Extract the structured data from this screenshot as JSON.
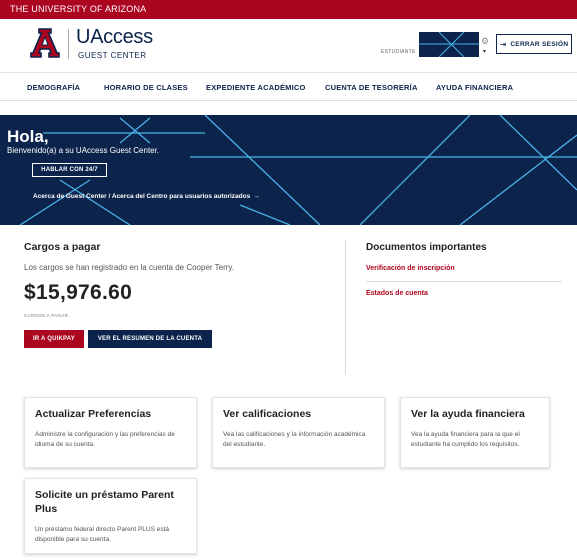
{
  "university_bar": {
    "text": "THE UNIVERSITY OF ARIZONA"
  },
  "header": {
    "logo_icon": "arizona-a-logo",
    "brand_title": "UAccess",
    "brand_subtitle": "GUEST CENTER",
    "student_label": "ESTUDIANTE",
    "settings_icon": "⚙",
    "caret_icon": "▾",
    "logout_icon": "⇥",
    "logout_label": "CERRAR SESIÓN"
  },
  "nav": {
    "items": [
      {
        "label": "DEMOGRAFÍA"
      },
      {
        "label": "HORARIO DE CLASES"
      },
      {
        "label": "EXPEDIENTE ACADÉMICO"
      },
      {
        "label": "CUENTA DE TESORERÍA"
      },
      {
        "label": "AYUDA FINANCIERA"
      }
    ]
  },
  "hero": {
    "greeting": "Hola,",
    "welcome": "Bienvenido(a) a su UAccess Guest Center.",
    "help_button": "HABLAR CON 24/7",
    "about_link": "Acerca de Guest Center / Acerca del Centro para usuarios autorizados",
    "about_arrow": "→"
  },
  "charges": {
    "title": "Cargos a pagar",
    "description": "Los cargos se han registrado en la cuenta de Cooper Terry.",
    "amount": "$15,976.60",
    "amount_label": "CARGOS A PAGAR",
    "quikpay_button": "IR A QUIKPAY",
    "summary_button": "VER EL RESUMEN DE LA CUENTA"
  },
  "documents": {
    "title": "Documentos importantes",
    "links": [
      {
        "label": "Verificación de inscripción"
      },
      {
        "label": "Estados de cuenta"
      }
    ]
  },
  "cards": [
    {
      "title": "Actualizar Preferencias",
      "description": "Administre la configuración y las preferencias de idioma de su cuenta."
    },
    {
      "title": "Ver calificaciones",
      "description": "Vea las calificaciones y la información académica del estudiante."
    },
    {
      "title": "Ver la ayuda financiera",
      "description": "Vea la ayuda financiera para la que el estudiante ha cumplido los requisitos."
    },
    {
      "title": "Solicite un préstamo Parent Plus",
      "description": "Un préstamo federal directo Parent PLUS está disponible para su cuenta."
    }
  ],
  "colors": {
    "brand_navy": "#0c234b",
    "brand_red": "#ab0520",
    "hero_line": "#49b3e6"
  }
}
